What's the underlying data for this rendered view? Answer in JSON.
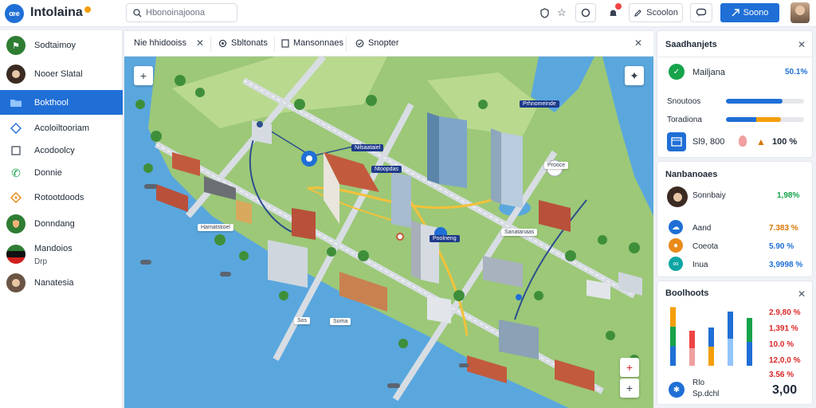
{
  "app": {
    "logo_text": "œe",
    "title": "Intolaina"
  },
  "search": {
    "value": "Hbonoinajoona"
  },
  "topbar": {
    "action_label": "Scoolon",
    "primary_label": "Soono"
  },
  "sidebar": {
    "items": [
      {
        "label": "Sodtaimoy"
      },
      {
        "label": "Nooer Slatal"
      },
      {
        "label": "Bokthool"
      },
      {
        "label": "Acoloiltooriam"
      },
      {
        "label": "Acodoolcy"
      },
      {
        "label": "Donnie"
      },
      {
        "label": "Rotootdoods"
      },
      {
        "label": "Donndang"
      },
      {
        "label": "Mandoios",
        "sub": "Drp"
      },
      {
        "label": "Nanatesia"
      }
    ]
  },
  "tabs": [
    {
      "label": "Nie hhidooiss"
    },
    {
      "label": "Sbltonats"
    },
    {
      "label": "Mansonnaes"
    },
    {
      "label": "Snopter"
    }
  ],
  "map": {
    "labels": [
      "Nilsaataiel",
      "Ntoopdas",
      "Prhnomeinde",
      "Hamatstioel",
      "Poolneng",
      "Soma",
      "Sanatanaas",
      "Sos",
      "Prooce"
    ]
  },
  "card1": {
    "title": "Saadhanjets",
    "head_label": "Mailjana",
    "head_pct": "50.1%",
    "bars": [
      {
        "label": "Snoutoos",
        "value": 0.72,
        "color": "#1f6fd6"
      },
      {
        "label": "Toradiona",
        "value": 0.7,
        "color": "#1f6fd6",
        "accent": "#f59e0b"
      }
    ],
    "footer_value": "Sl9, 800",
    "footer_total": "100 %"
  },
  "card2": {
    "title": "Nanbanoaes",
    "rows": [
      {
        "label": "Sonnbaiy",
        "value": "1,98%",
        "color": "#16a34a"
      },
      {
        "label": "Aand",
        "value": "7.383 %",
        "color": "#d97706"
      },
      {
        "label": "Coeota",
        "value": "5.90 %",
        "color": "#1f6fd6"
      },
      {
        "label": "Inua",
        "value": "3,9998 %",
        "color": "#1f6fd6"
      }
    ]
  },
  "card3": {
    "title": "Boolhoots",
    "chart_data": {
      "type": "bar",
      "series": [
        {
          "name": "",
          "values": [
            0.92,
            0.55,
            0.6,
            0.85,
            0.75
          ]
        }
      ]
    },
    "values": [
      {
        "value": "2.9,80 %",
        "color": "#dc2626"
      },
      {
        "value": "1,391 %",
        "color": "#dc2626"
      },
      {
        "value": "10.0 %",
        "color": "#dc2626"
      },
      {
        "value": "12,0,0 %",
        "color": "#dc2626"
      },
      {
        "value": "3.56 %",
        "color": "#dc2626"
      }
    ],
    "footer_title": "Rlo",
    "footer_sub": "Sp.dchl",
    "footer_value": "3,00"
  }
}
